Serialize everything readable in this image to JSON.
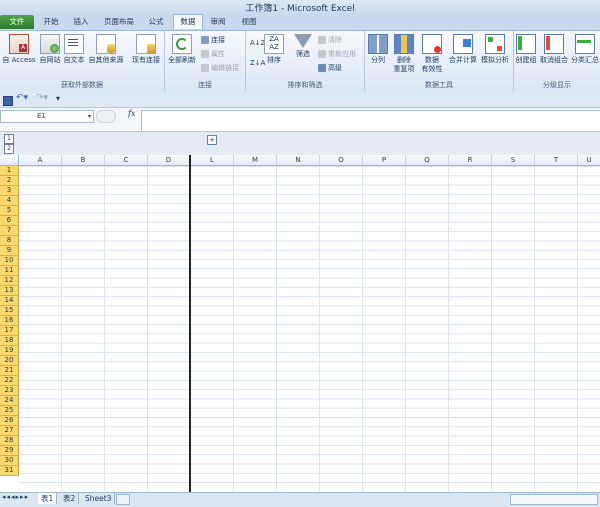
{
  "window": {
    "title": "工作簿1 - Microsoft Excel"
  },
  "tabs": {
    "file": "文件",
    "items": [
      "开始",
      "插入",
      "页面布局",
      "公式",
      "数据",
      "审阅",
      "视图"
    ],
    "active": "数据"
  },
  "ribbon": {
    "get_external": {
      "label": "获取外部数据",
      "access": "自 Access",
      "web": "自网站",
      "text": "自文本",
      "other": "自其他来源",
      "existing": "现有连接"
    },
    "connections": {
      "label": "连接",
      "refresh_all": "全部刷新",
      "connections": "连接",
      "properties": "属性",
      "edit_links": "编辑链接"
    },
    "sort_filter": {
      "label": "排序和筛选",
      "sort": "排序",
      "filter": "筛选",
      "clear": "清除",
      "reapply": "重新应用",
      "advanced": "高级"
    },
    "data_tools": {
      "label": "数据工具",
      "text_to_columns": "分列",
      "remove_duplicates_1": "删除",
      "remove_duplicates_2": "重复项",
      "validation_1": "数据",
      "validation_2": "有效性",
      "consolidate": "合并计算",
      "what_if": "模拟分析"
    },
    "outline": {
      "label": "分级显示",
      "group": "创建组",
      "ungroup": "取消组合",
      "subtotal": "分类汇总"
    }
  },
  "formula_bar": {
    "name_box": "E1",
    "fx": "fx",
    "formula": ""
  },
  "outline_levels": [
    "1",
    "2"
  ],
  "outline_expand": "+",
  "columns": [
    "A",
    "B",
    "C",
    "D",
    "L",
    "M",
    "N",
    "O",
    "P",
    "Q",
    "R",
    "S",
    "T",
    "U"
  ],
  "rows": [
    "1",
    "2",
    "3",
    "4",
    "5",
    "6",
    "7",
    "8",
    "9",
    "10",
    "11",
    "12",
    "13",
    "14",
    "15",
    "16",
    "17",
    "18",
    "19",
    "20",
    "21",
    "22",
    "23",
    "24",
    "25",
    "26",
    "27",
    "28",
    "29",
    "30",
    "31"
  ],
  "sheets": [
    "表1",
    "表2",
    "Sheet3"
  ],
  "active_sheet": "表1"
}
